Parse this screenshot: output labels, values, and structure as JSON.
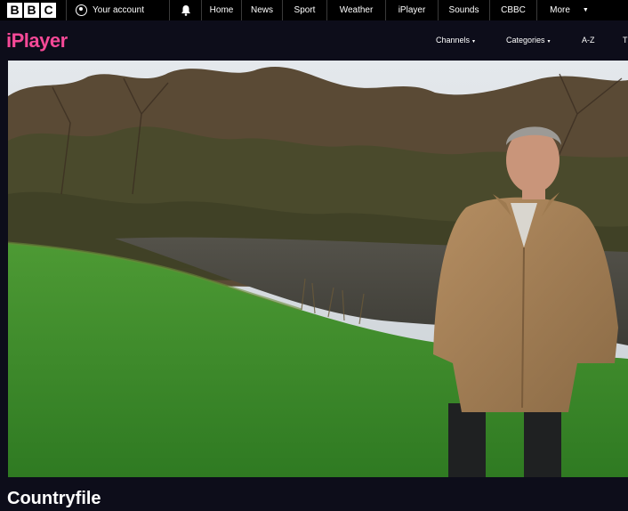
{
  "global_nav": {
    "logo_letters": [
      "B",
      "B",
      "C"
    ],
    "account_label": "Your account",
    "links": [
      {
        "label": "Home",
        "width": 45
      },
      {
        "label": "News",
        "width": 46
      },
      {
        "label": "Sport",
        "width": 50
      },
      {
        "label": "Weather",
        "width": 66
      },
      {
        "label": "iPlayer",
        "width": 59
      },
      {
        "label": "Sounds",
        "width": 58
      },
      {
        "label": "CBBC",
        "width": 53
      }
    ],
    "more_label": "More"
  },
  "iplayer": {
    "logo_text": "iPlayer",
    "menu": {
      "channels": "Channels",
      "categories": "Categories",
      "az": "A-Z",
      "overflow": "T"
    },
    "accent_color": "#f54997"
  },
  "programme": {
    "title": "Countryfile"
  }
}
